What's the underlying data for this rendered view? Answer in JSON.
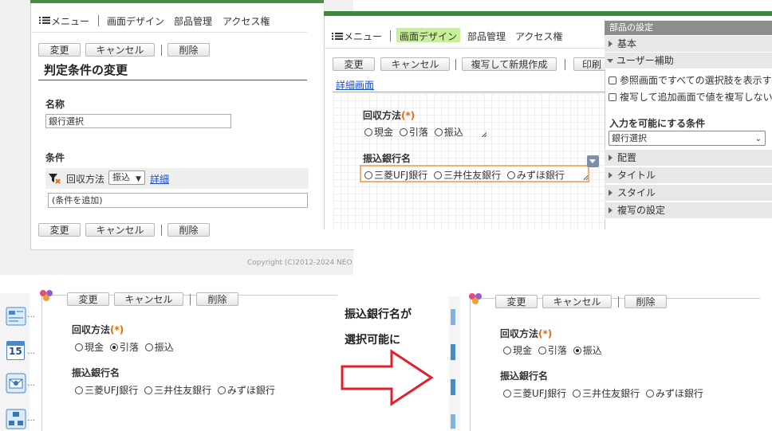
{
  "top_left": {
    "menu_label": "メニュー",
    "nav": [
      "画面デザイン",
      "部品管理",
      "アクセス権"
    ],
    "buttons": {
      "change": "変更",
      "cancel": "キャンセル",
      "delete": "削除"
    },
    "page_title": "判定条件の変更",
    "name_label": "名称",
    "name_value": "銀行選択",
    "conditions_label": "条件",
    "condition_field": "回収方法",
    "condition_select": "振込",
    "detail_link": "詳細",
    "add_condition": "(条件を追加)",
    "copyright": "Copyright (C)2012-2024 NEO"
  },
  "top_right": {
    "menu_label": "メニュー",
    "nav": [
      "画面デザイン",
      "部品管理",
      "アクセス権"
    ],
    "buttons": {
      "change": "変更",
      "cancel": "キャンセル",
      "copy_new": "複写して新規作成",
      "print": "印刷"
    },
    "detail_link": "詳細画面",
    "collection_label": "回収方法",
    "required_mark": "(*)",
    "collection_options": [
      "現金",
      "引落",
      "振込"
    ],
    "bank_label": "振込銀行名",
    "bank_options": [
      "三菱UFJ銀行",
      "三井住友銀行",
      "みずほ銀行"
    ]
  },
  "settings_panel": {
    "title": "部品の設定",
    "basic": "基本",
    "user_assist": "ユーザー補助",
    "option_show_all": "参照画面ですべての選択肢を表示す",
    "option_copy": "複写して追加画面で値を複写しない",
    "enable_condition_label": "入力を可能にする条件",
    "enable_condition_value": "銀行選択",
    "layout": "配置",
    "title_section": "タイトル",
    "style": "スタイル",
    "copy_settings": "複写の設定"
  },
  "bottom_left": {
    "buttons": {
      "change": "変更",
      "cancel": "キャンセル",
      "delete": "削除"
    },
    "collection_label": "回収方法",
    "required_mark": "(*)",
    "collection_options": [
      "現金",
      "引落",
      "振込"
    ],
    "selected_index": 1,
    "bank_label": "振込銀行名",
    "bank_options": [
      "三菱UFJ銀行",
      "三井住友銀行",
      "みずほ銀行"
    ],
    "calendar_day": "15"
  },
  "annotation": {
    "line1": "振込銀行名が",
    "line2": "選択可能に"
  },
  "bottom_right": {
    "buttons": {
      "change": "変更",
      "cancel": "キャンセル",
      "delete": "削除"
    },
    "collection_label": "回収方法",
    "required_mark": "(*)",
    "collection_options": [
      "現金",
      "引落",
      "振込"
    ],
    "selected_index": 2,
    "bank_label": "振込銀行名",
    "bank_options": [
      "三菱UFJ銀行",
      "三井住友銀行",
      "みずほ銀行"
    ]
  },
  "colors": {
    "accent_green": "#3d8a3d",
    "highlight_nav": "#c8ef9a",
    "required": "#e46c0a",
    "arrow_red": "#e0202a",
    "link": "#1a4fc4",
    "orange_border": "#f0b070"
  }
}
